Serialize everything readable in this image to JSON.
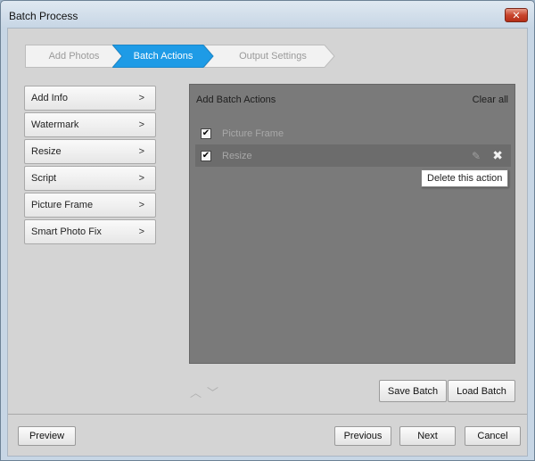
{
  "window": {
    "title": "Batch Process",
    "close_glyph": "✕"
  },
  "steps": [
    {
      "label": "Add Photos"
    },
    {
      "label": "Batch Actions"
    },
    {
      "label": "Output Settings"
    }
  ],
  "actions": [
    {
      "label": "Add Info"
    },
    {
      "label": "Watermark"
    },
    {
      "label": "Resize"
    },
    {
      "label": "Script"
    },
    {
      "label": "Picture Frame"
    },
    {
      "label": "Smart Photo Fix"
    }
  ],
  "action_chevron": ">",
  "panel": {
    "title": "Add Batch Actions",
    "clear_all": "Clear all",
    "rows": [
      {
        "label": "Picture Frame",
        "checked": true
      },
      {
        "label": "Resize",
        "checked": true
      }
    ]
  },
  "tooltip": "Delete this action",
  "icons": {
    "check": "✔",
    "edit": "✎",
    "delete": "✖",
    "up": "︿",
    "down": "﹀"
  },
  "buttons": {
    "save_batch": "Save Batch",
    "load_batch": "Load Batch",
    "preview": "Preview",
    "previous": "Previous",
    "next": "Next",
    "cancel": "Cancel"
  },
  "colors": {
    "active_step": "#1e9be6",
    "panel_bg": "#7a7a7a"
  }
}
